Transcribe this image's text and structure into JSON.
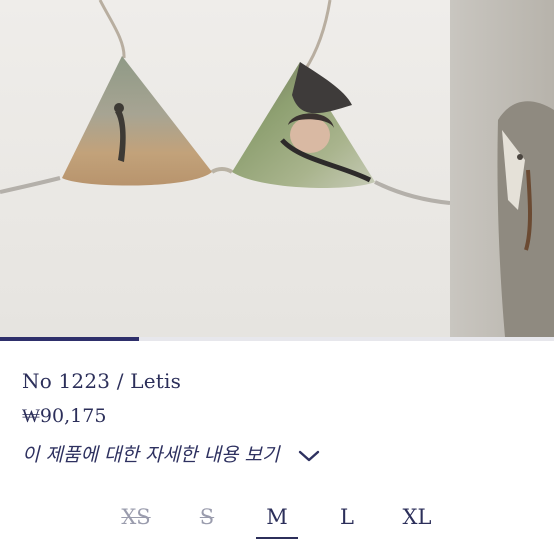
{
  "gallery": {
    "slide_count": 4,
    "current_slide": 1,
    "colors": {
      "accent": "#2e2f6b"
    }
  },
  "product": {
    "title": "No 1223 / Letis",
    "price": "₩90,175",
    "details_label": "이 제품에 대한 자세한 내용 보기"
  },
  "sizes": [
    {
      "label": "XS",
      "available": false,
      "selected": false
    },
    {
      "label": "S",
      "available": false,
      "selected": false
    },
    {
      "label": "M",
      "available": true,
      "selected": true
    },
    {
      "label": "L",
      "available": true,
      "selected": false
    },
    {
      "label": "XL",
      "available": true,
      "selected": false
    }
  ]
}
